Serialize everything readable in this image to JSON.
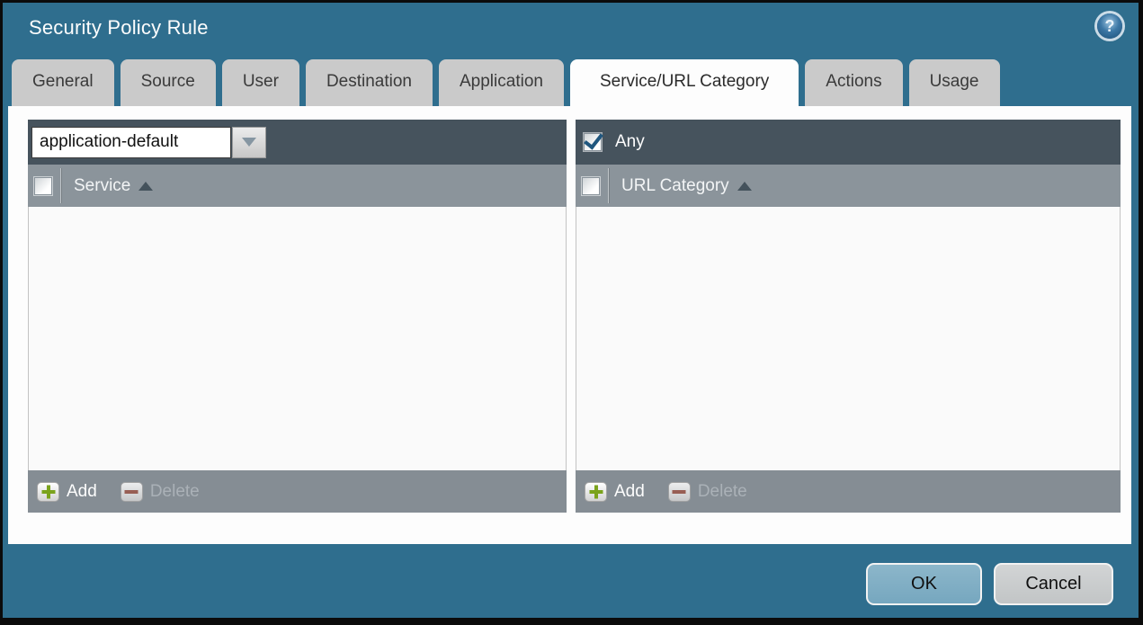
{
  "window": {
    "title": "Security Policy Rule"
  },
  "icons": {
    "help_glyph": "?"
  },
  "tabs": [
    {
      "label": "General",
      "active": false
    },
    {
      "label": "Source",
      "active": false
    },
    {
      "label": "User",
      "active": false
    },
    {
      "label": "Destination",
      "active": false
    },
    {
      "label": "Application",
      "active": false
    },
    {
      "label": "Service/URL Category",
      "active": true
    },
    {
      "label": "Actions",
      "active": false
    },
    {
      "label": "Usage",
      "active": false
    }
  ],
  "service_panel": {
    "dropdown_value": "application-default",
    "column_header": "Service",
    "sort_order": "ascending",
    "rows": [],
    "add_label": "Add",
    "delete_label": "Delete",
    "delete_enabled": false
  },
  "url_category_panel": {
    "any_label": "Any",
    "any_checked": true,
    "column_header": "URL Category",
    "sort_order": "ascending",
    "rows": [],
    "add_label": "Add",
    "delete_label": "Delete",
    "delete_enabled": false
  },
  "buttons": {
    "ok": "OK",
    "cancel": "Cancel"
  },
  "colors": {
    "background_teal": "#2f6e8e",
    "border_black": "#0b0b0b",
    "bar_slate": "#46535d",
    "header_gray": "#8b949b",
    "footer_gray": "#858d94",
    "body_bg": "#fafafa",
    "tab_gray": "#cacaca",
    "ok_blue": "#7fafc6",
    "cancel_gray": "#c8cbcc",
    "add_green": "#7ba31c",
    "delete_red": "#9c5649",
    "check_blue": "#1f567e"
  }
}
